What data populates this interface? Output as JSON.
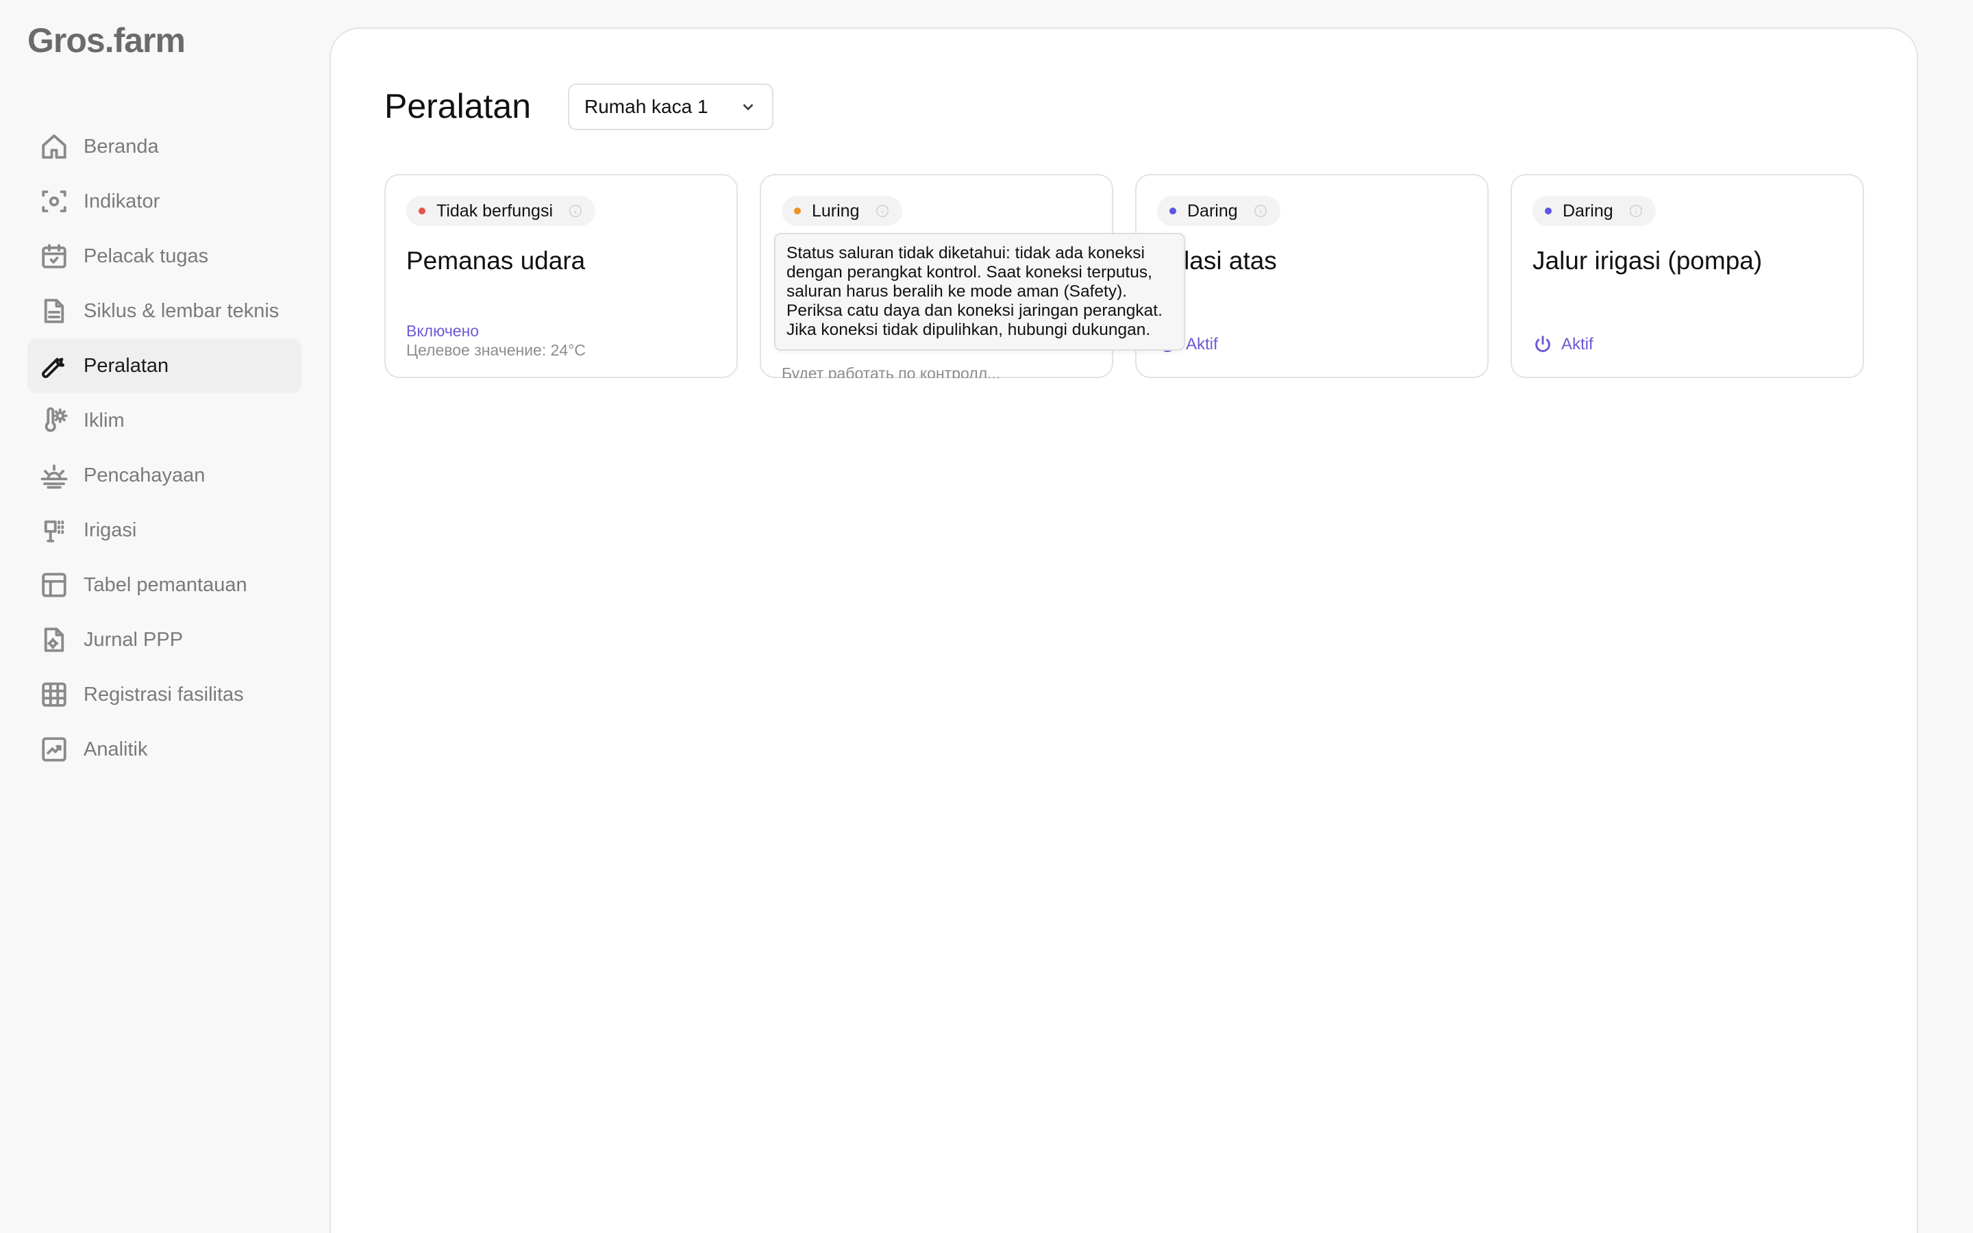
{
  "app": {
    "logo": "Gros.farm"
  },
  "sidebar": {
    "items": [
      {
        "label": "Beranda",
        "icon": "home-icon"
      },
      {
        "label": "Indikator",
        "icon": "sensor-icon"
      },
      {
        "label": "Pelacak tugas",
        "icon": "calendar-check-icon"
      },
      {
        "label": "Siklus & lembar teknis",
        "icon": "document-icon"
      },
      {
        "label": "Peralatan",
        "icon": "wrench-icon",
        "active": true
      },
      {
        "label": "Iklim",
        "icon": "thermometer-sun-icon"
      },
      {
        "label": "Pencahayaan",
        "icon": "sunrise-icon"
      },
      {
        "label": "Irigasi",
        "icon": "sprinkler-icon"
      },
      {
        "label": "Tabel pemantauan",
        "icon": "table-icon"
      },
      {
        "label": "Jurnal PPP",
        "icon": "file-gear-icon"
      },
      {
        "label": "Registrasi fasilitas",
        "icon": "grid-icon"
      },
      {
        "label": "Analitik",
        "icon": "chart-line-icon"
      }
    ]
  },
  "main": {
    "title": "Peralatan",
    "greenhouse_select": {
      "value": "Rumah kaca 1"
    },
    "cards": [
      {
        "status": "Tidak berfungsi",
        "status_color": "#e5534b",
        "title": "Pemanas udara",
        "state_label": "Включено",
        "target_label": "Целевое значение: 24°C"
      },
      {
        "status": "Luring",
        "status_color": "#f0921e",
        "title": "",
        "hidden_line": "Будет работать по конт­ролл...",
        "tooltip": "Status saluran tidak diketahui: tidak ada koneksi dengan perangkat kontrol. Saat koneksi terputus, saluran harus beralih ke mode aman (Safety). Periksa catu daya dan koneksi jaringan perangkat. Jika koneksi tidak dipulihkan, hubungi dukungan."
      },
      {
        "status": "Daring",
        "status_color": "#5b57e0",
        "title": "ntilasi atas",
        "power_label": "Aktif"
      },
      {
        "status": "Daring",
        "status_color": "#5b57e0",
        "title": "Jalur irigasi (pompa)",
        "power_label": "Aktif"
      }
    ]
  }
}
